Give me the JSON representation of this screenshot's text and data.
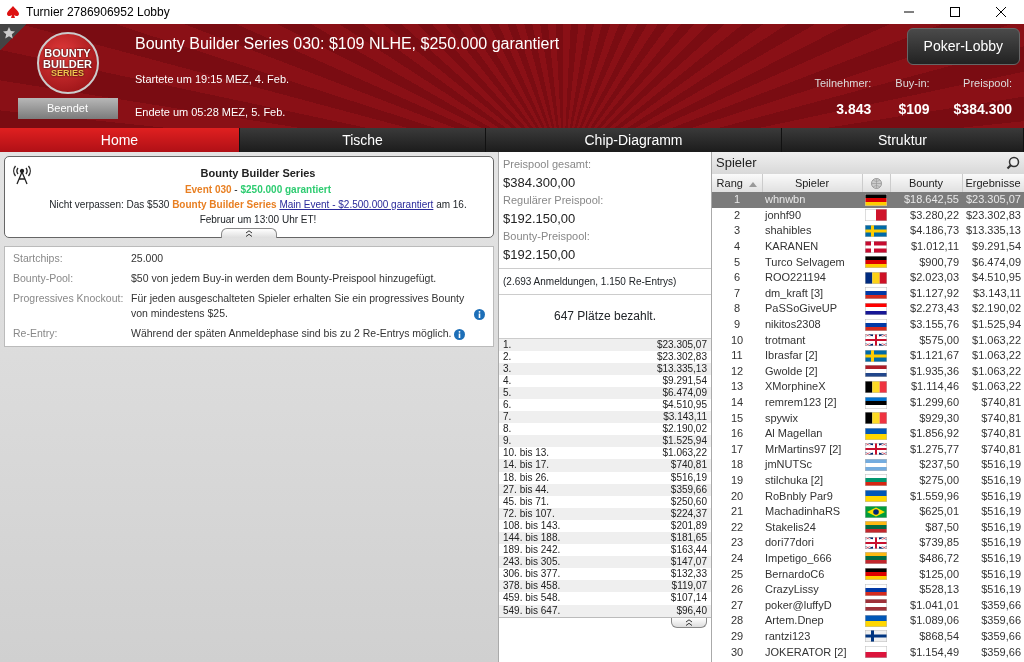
{
  "window": {
    "title": "Turnier 2786906952 Lobby"
  },
  "header": {
    "logo_lines": [
      "BOUNTY",
      "BUILDER",
      "SERIES"
    ],
    "status": "Beendet",
    "title": "Bounty Builder Series 030: $109 NLHE, $250.000 garantiert",
    "started": "Startete um 19:15 MEZ, 4. Feb.",
    "ended": "Endete um 05:28 MEZ, 5. Feb.",
    "lobby_button": "Poker-Lobby",
    "stats": [
      {
        "label": "Teilnehmer:",
        "value": "3.843"
      },
      {
        "label": "Buy-in:",
        "value": "$109"
      },
      {
        "label": "Preispool:",
        "value": "$384.300"
      }
    ]
  },
  "tabs": [
    {
      "label": "Home",
      "selected": true
    },
    {
      "label": "Tische",
      "selected": false
    },
    {
      "label": "Chip-Diagramm",
      "selected": false
    },
    {
      "label": "Struktur",
      "selected": false
    }
  ],
  "announcement": {
    "heading": "Bounty Builder Series",
    "event_line": [
      {
        "kind": "highlight",
        "text": "Event 030"
      },
      {
        "kind": "plain",
        "text": " - "
      },
      {
        "kind": "guarantee",
        "text": "$250.000 garantiert"
      }
    ],
    "message": [
      {
        "kind": "plain",
        "text": "Nicht verpassen: Das $530 "
      },
      {
        "kind": "highlight",
        "text": "Bounty Builder Series "
      },
      {
        "kind": "link",
        "text": "Main Event - $2.500.000 garantiert"
      },
      {
        "kind": "plain",
        "text": " am 16. Februar um 13:00 Uhr ET!"
      }
    ]
  },
  "info_rows": [
    {
      "label": "Startchips:",
      "value": "25.000",
      "info": false
    },
    {
      "label": "Bounty-Pool:",
      "value": "$50 von jedem Buy-in werden dem Bounty-Preispool hinzugefügt.",
      "info": false
    },
    {
      "label": "Progressives Knockout:",
      "value": "Für jeden ausgeschalteten Spieler erhalten Sie ein progressives Bounty von mindestens $25.",
      "info": true
    },
    {
      "label": "Re-Entry:",
      "value": "Während der späten Anmeldephase sind bis zu 2 Re-Entrys möglich.",
      "info": true
    }
  ],
  "prize_pool": {
    "items": [
      {
        "label": "Preispool gesamt:",
        "value": "$384.300,00"
      },
      {
        "label": "Regulärer Preispool:",
        "value": "$192.150,00"
      },
      {
        "label": "Bounty-Preispool:",
        "value": "$192.150,00"
      }
    ],
    "entries": "(2.693 Anmeldungen, 1.150 Re-Entrys)",
    "paid": "647 Plätze bezahlt.",
    "prizes": [
      {
        "place": "1.",
        "amount": "$23.305,07"
      },
      {
        "place": "2.",
        "amount": "$23.302,83"
      },
      {
        "place": "3.",
        "amount": "$13.335,13"
      },
      {
        "place": "4.",
        "amount": "$9.291,54"
      },
      {
        "place": "5.",
        "amount": "$6.474,09"
      },
      {
        "place": "6.",
        "amount": "$4.510,95"
      },
      {
        "place": "7.",
        "amount": "$3.143,11"
      },
      {
        "place": "8.",
        "amount": "$2.190,02"
      },
      {
        "place": "9.",
        "amount": "$1.525,94"
      },
      {
        "place": "10. bis 13.",
        "amount": "$1.063,22"
      },
      {
        "place": "14. bis 17.",
        "amount": "$740,81"
      },
      {
        "place": "18. bis 26.",
        "amount": "$516,19"
      },
      {
        "place": "27. bis 44.",
        "amount": "$359,66"
      },
      {
        "place": "45. bis 71.",
        "amount": "$250,60"
      },
      {
        "place": "72. bis 107.",
        "amount": "$224,37"
      },
      {
        "place": "108. bis 143.",
        "amount": "$201,89"
      },
      {
        "place": "144. bis 188.",
        "amount": "$181,65"
      },
      {
        "place": "189. bis 242.",
        "amount": "$163,44"
      },
      {
        "place": "243. bis 305.",
        "amount": "$147,07"
      },
      {
        "place": "306. bis 377.",
        "amount": "$132,33"
      },
      {
        "place": "378. bis 458.",
        "amount": "$119,07"
      },
      {
        "place": "459. bis 548.",
        "amount": "$107,14"
      },
      {
        "place": "549. bis 647.",
        "amount": "$96,40"
      }
    ]
  },
  "players": {
    "title": "Spieler",
    "columns": [
      {
        "label": "Rang",
        "sorted": true
      },
      {
        "label": "Spieler",
        "sorted": false
      },
      {
        "label": "Bounty",
        "sorted": false
      },
      {
        "label": "Ergebnisse",
        "sorted": false
      }
    ],
    "rows": [
      {
        "rank": "1",
        "name": "whnwbn",
        "flag": {
          "kind": "h",
          "stripes": [
            {
              "color": "#000000"
            },
            {
              "color": "#dd0000"
            },
            {
              "color": "#ffcc00"
            }
          ]
        },
        "bounty": "$18.642,55",
        "result": "$23.305,07",
        "selected": true
      },
      {
        "rank": "2",
        "name": "jonhf90",
        "flag": {
          "kind": "v",
          "stripes": [
            {
              "color": "#ffffff"
            },
            {
              "color": "#cf142b"
            }
          ]
        },
        "bounty": "$3.280,22",
        "result": "$23.302,83",
        "selected": false
      },
      {
        "rank": "3",
        "name": "shahibles",
        "flag": {
          "kind": "cross",
          "stripes": [
            {
              "color": "#006aa7"
            },
            {
              "color": "#fecc00"
            }
          ]
        },
        "bounty": "$4.186,73",
        "result": "$13.335,13",
        "selected": false
      },
      {
        "rank": "4",
        "name": "KARANEN",
        "flag": {
          "kind": "cross",
          "stripes": [
            {
              "color": "#c60c30"
            },
            {
              "color": "#ffffff"
            }
          ]
        },
        "bounty": "$1.012,11",
        "result": "$9.291,54",
        "selected": false
      },
      {
        "rank": "5",
        "name": "Turco Selvagem",
        "flag": {
          "kind": "h",
          "stripes": [
            {
              "color": "#000000"
            },
            {
              "color": "#dd0000"
            },
            {
              "color": "#ffcc00"
            }
          ]
        },
        "bounty": "$900,79",
        "result": "$6.474,09",
        "selected": false
      },
      {
        "rank": "6",
        "name": "ROO221194",
        "flag": {
          "kind": "v",
          "stripes": [
            {
              "color": "#002b7f"
            },
            {
              "color": "#fcd116"
            },
            {
              "color": "#ce1126"
            }
          ]
        },
        "bounty": "$2.023,03",
        "result": "$4.510,95",
        "selected": false
      },
      {
        "rank": "7",
        "name": "dm_kraft [3]",
        "flag": {
          "kind": "h",
          "stripes": [
            {
              "color": "#ffffff"
            },
            {
              "color": "#0039a6"
            },
            {
              "color": "#d52b1e"
            }
          ]
        },
        "bounty": "$1.127,92",
        "result": "$3.143,11",
        "selected": false
      },
      {
        "rank": "8",
        "name": "PaSSoGiveUP",
        "flag": {
          "kind": "h",
          "stripes": [
            {
              "color": "#ff0000"
            },
            {
              "color": "#ffffff"
            },
            {
              "color": "#171796"
            }
          ]
        },
        "bounty": "$2.273,43",
        "result": "$2.190,02",
        "selected": false
      },
      {
        "rank": "9",
        "name": "nikitos2308",
        "flag": {
          "kind": "h",
          "stripes": [
            {
              "color": "#ffffff"
            },
            {
              "color": "#0039a6"
            },
            {
              "color": "#d52b1e"
            }
          ]
        },
        "bounty": "$3.155,76",
        "result": "$1.525,94",
        "selected": false
      },
      {
        "rank": "10",
        "name": "trotmant",
        "flag": {
          "kind": "union",
          "stripes": [
            {
              "color": "#012169"
            },
            {
              "color": "#ffffff"
            },
            {
              "color": "#c8102e"
            }
          ]
        },
        "bounty": "$575,00",
        "result": "$1.063,22",
        "selected": false
      },
      {
        "rank": "11",
        "name": "Ibrasfar [2]",
        "flag": {
          "kind": "cross",
          "stripes": [
            {
              "color": "#006aa7"
            },
            {
              "color": "#fecc00"
            }
          ]
        },
        "bounty": "$1.121,67",
        "result": "$1.063,22",
        "selected": false
      },
      {
        "rank": "12",
        "name": "Gwolde [2]",
        "flag": {
          "kind": "h",
          "stripes": [
            {
              "color": "#ae1c28"
            },
            {
              "color": "#ffffff"
            },
            {
              "color": "#21468b"
            }
          ]
        },
        "bounty": "$1.935,36",
        "result": "$1.063,22",
        "selected": false
      },
      {
        "rank": "13",
        "name": "XMorphineX",
        "flag": {
          "kind": "v",
          "stripes": [
            {
              "color": "#000000"
            },
            {
              "color": "#fdda24"
            },
            {
              "color": "#ef3340"
            }
          ]
        },
        "bounty": "$1.114,46",
        "result": "$1.063,22",
        "selected": false
      },
      {
        "rank": "14",
        "name": "remrem123 [2]",
        "flag": {
          "kind": "h",
          "stripes": [
            {
              "color": "#0072ce"
            },
            {
              "color": "#000000"
            },
            {
              "color": "#ffffff"
            }
          ]
        },
        "bounty": "$1.299,60",
        "result": "$740,81",
        "selected": false
      },
      {
        "rank": "15",
        "name": "spywix",
        "flag": {
          "kind": "v",
          "stripes": [
            {
              "color": "#000000"
            },
            {
              "color": "#fdda24"
            },
            {
              "color": "#ef3340"
            }
          ]
        },
        "bounty": "$929,30",
        "result": "$740,81",
        "selected": false
      },
      {
        "rank": "16",
        "name": "Al Magellan",
        "flag": {
          "kind": "h",
          "stripes": [
            {
              "color": "#0057b7"
            },
            {
              "color": "#ffd700"
            }
          ]
        },
        "bounty": "$1.856,92",
        "result": "$740,81",
        "selected": false
      },
      {
        "rank": "17",
        "name": "MrMartins97 [2]",
        "flag": {
          "kind": "union",
          "stripes": [
            {
              "color": "#012169"
            },
            {
              "color": "#ffffff"
            },
            {
              "color": "#c8102e"
            }
          ]
        },
        "bounty": "$1.275,77",
        "result": "$740,81",
        "selected": false
      },
      {
        "rank": "18",
        "name": "jmNUTSc",
        "flag": {
          "kind": "h",
          "stripes": [
            {
              "color": "#74acdf"
            },
            {
              "color": "#ffffff"
            },
            {
              "color": "#74acdf"
            }
          ]
        },
        "bounty": "$237,50",
        "result": "$516,19",
        "selected": false
      },
      {
        "rank": "19",
        "name": "stilchuka [2]",
        "flag": {
          "kind": "h",
          "stripes": [
            {
              "color": "#ffffff"
            },
            {
              "color": "#00966e"
            },
            {
              "color": "#d62612"
            }
          ]
        },
        "bounty": "$275,00",
        "result": "$516,19",
        "selected": false
      },
      {
        "rank": "20",
        "name": "RoBnbly Par9",
        "flag": {
          "kind": "h",
          "stripes": [
            {
              "color": "#0057b7"
            },
            {
              "color": "#ffd700"
            }
          ]
        },
        "bounty": "$1.559,96",
        "result": "$516,19",
        "selected": false
      },
      {
        "rank": "21",
        "name": "MachadinhaRS",
        "flag": {
          "kind": "diamond",
          "stripes": [
            {
              "color": "#009c3b"
            },
            {
              "color": "#ffdf00"
            },
            {
              "color": "#002776"
            }
          ]
        },
        "bounty": "$625,01",
        "result": "$516,19",
        "selected": false
      },
      {
        "rank": "22",
        "name": "Stakelis24",
        "flag": {
          "kind": "h",
          "stripes": [
            {
              "color": "#fdb913"
            },
            {
              "color": "#006a44"
            },
            {
              "color": "#c1272d"
            }
          ]
        },
        "bounty": "$87,50",
        "result": "$516,19",
        "selected": false
      },
      {
        "rank": "23",
        "name": "dori77dori",
        "flag": {
          "kind": "union",
          "stripes": [
            {
              "color": "#012169"
            },
            {
              "color": "#ffffff"
            },
            {
              "color": "#c8102e"
            }
          ]
        },
        "bounty": "$739,85",
        "result": "$516,19",
        "selected": false
      },
      {
        "rank": "24",
        "name": "Impetigo_666",
        "flag": {
          "kind": "h",
          "stripes": [
            {
              "color": "#fdb913"
            },
            {
              "color": "#006a44"
            },
            {
              "color": "#c1272d"
            }
          ]
        },
        "bounty": "$486,72",
        "result": "$516,19",
        "selected": false
      },
      {
        "rank": "25",
        "name": "BernardoC6",
        "flag": {
          "kind": "h",
          "stripes": [
            {
              "color": "#000000"
            },
            {
              "color": "#dd0000"
            },
            {
              "color": "#ffcc00"
            }
          ]
        },
        "bounty": "$125,00",
        "result": "$516,19",
        "selected": false
      },
      {
        "rank": "26",
        "name": "CrazyLissy",
        "flag": {
          "kind": "h",
          "stripes": [
            {
              "color": "#ffffff"
            },
            {
              "color": "#0039a6"
            },
            {
              "color": "#d52b1e"
            }
          ]
        },
        "bounty": "$528,13",
        "result": "$516,19",
        "selected": false
      },
      {
        "rank": "27",
        "name": "poker@luffyD",
        "flag": {
          "kind": "h",
          "stripes": [
            {
              "color": "#9e3039"
            },
            {
              "color": "#ffffff"
            },
            {
              "color": "#9e3039"
            }
          ]
        },
        "bounty": "$1.041,01",
        "result": "$359,66",
        "selected": false
      },
      {
        "rank": "28",
        "name": "Artem.Dnep",
        "flag": {
          "kind": "h",
          "stripes": [
            {
              "color": "#0057b7"
            },
            {
              "color": "#ffd700"
            }
          ]
        },
        "bounty": "$1.089,06",
        "result": "$359,66",
        "selected": false
      },
      {
        "rank": "29",
        "name": "rantzi123",
        "flag": {
          "kind": "cross",
          "stripes": [
            {
              "color": "#f0f0f0"
            },
            {
              "color": "#003580"
            }
          ]
        },
        "bounty": "$868,54",
        "result": "$359,66",
        "selected": false
      },
      {
        "rank": "30",
        "name": "JOKERATOR [2]",
        "flag": {
          "kind": "h",
          "stripes": [
            {
              "color": "#ffffff"
            },
            {
              "color": "#dc143c"
            }
          ]
        },
        "bounty": "$1.154,49",
        "result": "$359,66",
        "selected": false
      }
    ]
  }
}
